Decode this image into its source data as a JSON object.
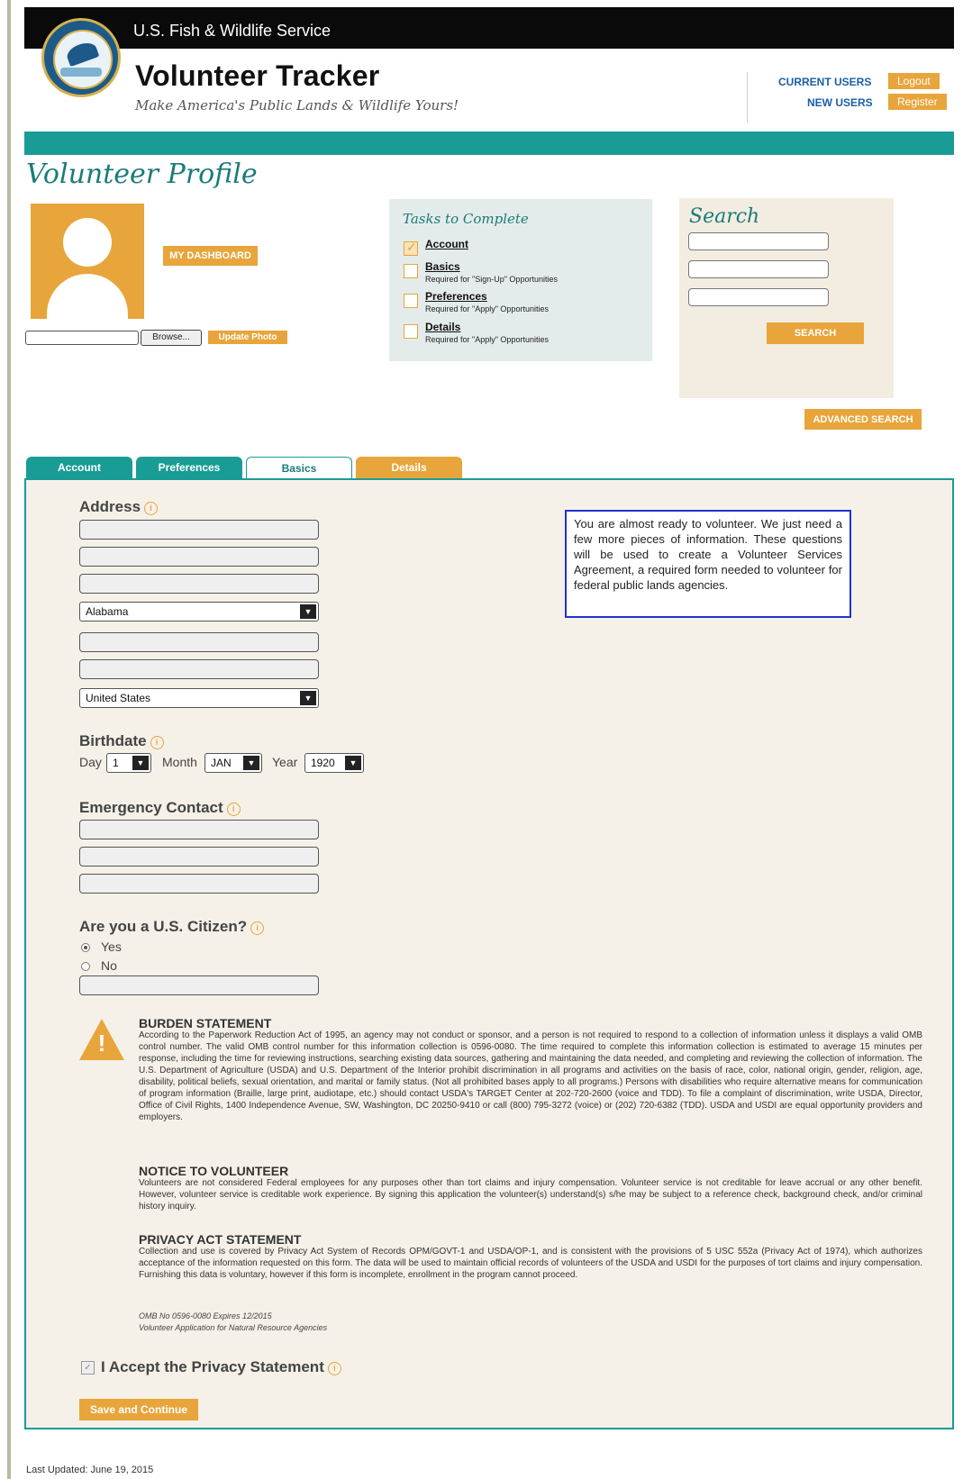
{
  "header": {
    "agency": "U.S. Fish & Wildlife Service",
    "app_title": "Volunteer Tracker",
    "tagline": "Make America's Public Lands & Wildlife Yours!",
    "current_users_label": "CURRENT USERS",
    "logout_label": "Logout",
    "new_users_label": "NEW USERS",
    "register_label": "Register"
  },
  "page_title": "Volunteer Profile",
  "profile": {
    "dashboard_label": "MY DASHBOARD",
    "browse_label": "Browse...",
    "update_photo_label": "Update Photo"
  },
  "tasks": {
    "title": "Tasks to Complete",
    "items": [
      {
        "label": "Account",
        "note": "",
        "checked": true
      },
      {
        "label": "Basics",
        "note": "Required for \"Sign-Up\" Opportunities",
        "checked": false
      },
      {
        "label": "Preferences",
        "note": "Required for \"Apply\" Opportunities",
        "checked": false
      },
      {
        "label": "Details",
        "note": "Required for \"Apply\" Opportunities",
        "checked": false
      }
    ]
  },
  "search": {
    "title": "Search",
    "search_label": "SEARCH",
    "advanced_label": "ADVANCED SEARCH"
  },
  "tabs": [
    "Account",
    "Preferences",
    "Basics",
    "Details"
  ],
  "form": {
    "address_label": "Address",
    "state_value": "Alabama",
    "country_value": "United States",
    "birthdate_label": "Birthdate",
    "day_label": "Day",
    "day_value": "1",
    "month_label": "Month",
    "month_value": "JAN",
    "year_label": "Year",
    "year_value": "1920",
    "emergency_label": "Emergency Contact",
    "citizen_label": "Are you a U.S. Citizen?",
    "yes_label": "Yes",
    "no_label": "No",
    "info_text": "You are almost ready to volunteer. We just need a few more pieces of information. These questions will be used to create a Volunteer Services Agreement, a required form needed to volunteer for federal public lands agencies.",
    "accept_label": "I Accept the Privacy Statement",
    "save_label": "Save and Continue"
  },
  "statements": {
    "burden_title": "BURDEN STATEMENT",
    "burden_text": "According to the Paperwork Reduction Act of 1995, an agency may not conduct or sponsor, and a person is not required to respond to a collection of information unless it displays a valid OMB control number. The valid OMB control number for this information collection is 0596-0080. The time required to complete this information collection is estimated to average 15 minutes per response, including the time for reviewing instructions, searching existing data sources, gathering and maintaining the data needed, and completing and reviewing the collection of information. The U.S. Department of Agriculture (USDA) and U.S. Department of the Interior prohibit discrimination in all programs and activities on the basis of race, color, national origin, gender, religion, age, disability, political beliefs, sexual orientation, and marital or family status. (Not all prohibited bases apply to all programs.) Persons with disabilities who require alternative means for communication of program information (Braille, large print, audiotape, etc.) should contact USDA's TARGET Center at 202-720-2600 (voice and TDD). To file a complaint of discrimination, write USDA, Director, Office of Civil Rights, 1400 Independence Avenue, SW, Washington, DC 20250-9410 or call (800) 795-3272 (voice) or (202) 720-6382 (TDD). USDA and USDI are equal opportunity providers and employers.",
    "notice_title": "NOTICE TO VOLUNTEER",
    "notice_text": "Volunteers are not considered Federal employees for any purposes other than tort claims and injury compensation. Volunteer service is not creditable for leave accrual or any other benefit. However, volunteer service is creditable work experience. By signing this application the volunteer(s) understand(s) s/he may be subject to a reference check, background check, and/or criminal history inquiry.",
    "privacy_title": "PRIVACY ACT STATEMENT",
    "privacy_text": "Collection and use is covered by Privacy Act System of Records OPM/GOVT-1 and USDA/OP-1, and is consistent with the provisions of 5 USC 552a (Privacy Act of 1974), which authorizes acceptance of the information requested on this form. The data will be used to maintain official records of volunteers of the USDA and USDI for the purposes of tort claims and injury compensation. Furnishing this data is voluntary, however if this form is incomplete, enrollment in the program cannot proceed.",
    "omb_line1": "OMB No 0596-0080 Expires 12/2015",
    "omb_line2": "Volunteer Application for Natural Resource Agencies"
  },
  "footer": {
    "last_updated": "Last Updated: June 19, 2015"
  },
  "colors": {
    "teal": "#1a9c96",
    "orange": "#e8a53b",
    "panel_bg": "#f5f1e8"
  }
}
